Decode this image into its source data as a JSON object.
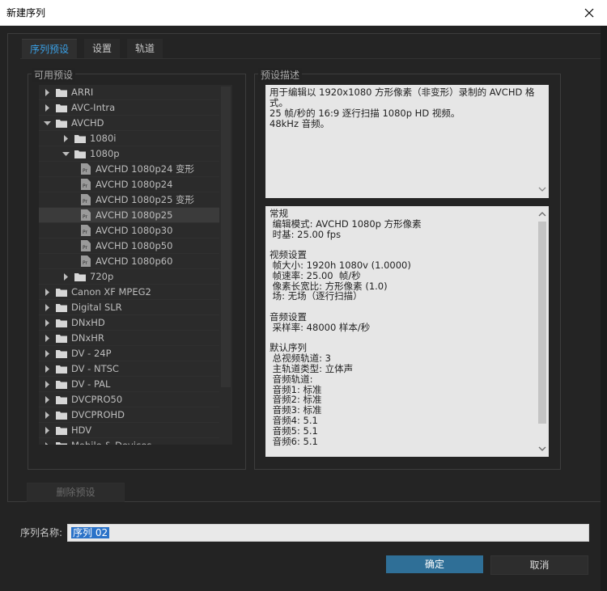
{
  "window": {
    "title": "新建序列"
  },
  "tabs": [
    {
      "label": "序列预设",
      "active": true
    },
    {
      "label": "设置",
      "active": false
    },
    {
      "label": "轨道",
      "active": false
    }
  ],
  "available_presets": {
    "label": "可用预设",
    "items": [
      {
        "label": "ARRI",
        "level": 0,
        "type": "folder",
        "expanded": false
      },
      {
        "label": "AVC-Intra",
        "level": 0,
        "type": "folder",
        "expanded": false
      },
      {
        "label": "AVCHD",
        "level": 0,
        "type": "folder",
        "expanded": true
      },
      {
        "label": "1080i",
        "level": 1,
        "type": "folder",
        "expanded": false
      },
      {
        "label": "1080p",
        "level": 1,
        "type": "folder",
        "expanded": true
      },
      {
        "label": "AVCHD 1080p24 变形",
        "level": 2,
        "type": "preset"
      },
      {
        "label": "AVCHD 1080p24",
        "level": 2,
        "type": "preset"
      },
      {
        "label": "AVCHD 1080p25 变形",
        "level": 2,
        "type": "preset"
      },
      {
        "label": "AVCHD 1080p25",
        "level": 2,
        "type": "preset",
        "selected": true
      },
      {
        "label": "AVCHD 1080p30",
        "level": 2,
        "type": "preset"
      },
      {
        "label": "AVCHD 1080p50",
        "level": 2,
        "type": "preset"
      },
      {
        "label": "AVCHD 1080p60",
        "level": 2,
        "type": "preset"
      },
      {
        "label": "720p",
        "level": 1,
        "type": "folder",
        "expanded": false
      },
      {
        "label": "Canon XF MPEG2",
        "level": 0,
        "type": "folder",
        "expanded": false
      },
      {
        "label": "Digital SLR",
        "level": 0,
        "type": "folder",
        "expanded": false
      },
      {
        "label": "DNxHD",
        "level": 0,
        "type": "folder",
        "expanded": false
      },
      {
        "label": "DNxHR",
        "level": 0,
        "type": "folder",
        "expanded": false
      },
      {
        "label": "DV - 24P",
        "level": 0,
        "type": "folder",
        "expanded": false
      },
      {
        "label": "DV - NTSC",
        "level": 0,
        "type": "folder",
        "expanded": false
      },
      {
        "label": "DV - PAL",
        "level": 0,
        "type": "folder",
        "expanded": false
      },
      {
        "label": "DVCPRO50",
        "level": 0,
        "type": "folder",
        "expanded": false
      },
      {
        "label": "DVCPROHD",
        "level": 0,
        "type": "folder",
        "expanded": false
      },
      {
        "label": "HDV",
        "level": 0,
        "type": "folder",
        "expanded": false
      },
      {
        "label": "Mobile & Devices",
        "level": 0,
        "type": "folder",
        "expanded": false
      }
    ]
  },
  "preset_description": {
    "label": "预设描述",
    "text": "用于编辑以 1920x1080 方形像素（非变形）录制的 AVCHD 格\n式。\n25 帧/秒的 16:9 逐行扫描 1080p HD 视频。\n48kHz 音频。"
  },
  "details": {
    "text": "常规\n 编辑模式: AVCHD 1080p 方形像素\n 时基: 25.00 fps\n\n视频设置\n 帧大小: 1920h 1080v (1.0000)\n 帧速率: 25.00  帧/秒\n 像素长宽比: 方形像素 (1.0)\n 场: 无场（逐行扫描）\n\n音频设置\n 采样率: 48000 样本/秒\n\n默认序列\n 总视频轨道: 3\n 主轨道类型: 立体声\n 音频轨道:\n 音频1: 标准\n 音频2: 标准\n 音频3: 标准\n 音频4: 5.1\n 音频5: 5.1\n 音频6: 5.1"
  },
  "delete_preset_label": "删除预设",
  "sequence_name": {
    "label": "序列名称:",
    "value": "序列 02"
  },
  "buttons": {
    "ok": "确定",
    "cancel": "取消"
  },
  "colors": {
    "accent": "#3aa0e6",
    "ok_button": "#2f6f97",
    "selection": "#2a72c8"
  }
}
